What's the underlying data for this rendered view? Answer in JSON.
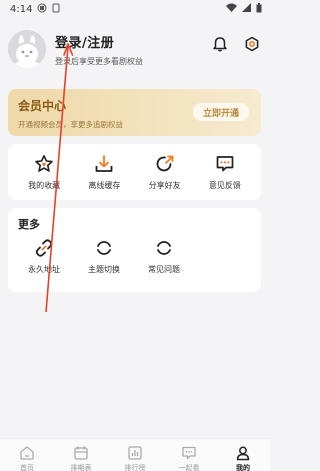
{
  "status_bar": {
    "time": "4:14"
  },
  "profile": {
    "title": "登录/注册",
    "subtitle": "登录后享受更多看剧权益",
    "icons": [
      "bell-icon",
      "settings-hex-icon"
    ]
  },
  "member": {
    "title": "会员中心",
    "subtitle": "开通视频会员，享更多追剧权益",
    "button": "立即开通"
  },
  "quick_actions": [
    {
      "label": "我的收藏",
      "icon": "star-icon"
    },
    {
      "label": "离线缓存",
      "icon": "download-icon"
    },
    {
      "label": "分享好友",
      "icon": "share-icon"
    },
    {
      "label": "意见反馈",
      "icon": "feedback-icon"
    }
  ],
  "more": {
    "title": "更多",
    "items": [
      {
        "label": "永久地址",
        "icon": "link-icon"
      },
      {
        "label": "主题切换",
        "icon": "loading-icon"
      },
      {
        "label": "常见问题",
        "icon": "loading-icon"
      }
    ]
  },
  "bottom_nav": [
    {
      "label": "首页",
      "icon": "home-icon"
    },
    {
      "label": "排期表",
      "icon": "calendar-icon"
    },
    {
      "label": "排行榜",
      "icon": "chart-icon"
    },
    {
      "label": "一起看",
      "icon": "chat-icon"
    },
    {
      "label": "我的",
      "icon": "profile-icon",
      "active": true
    }
  ],
  "colors": {
    "accent_orange": "#f07d1a",
    "member_gold": "#8a5a12",
    "arrow_red": "#e0452b"
  }
}
